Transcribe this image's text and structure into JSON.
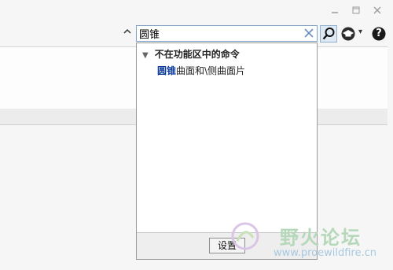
{
  "window": {
    "minimize_icon": "minimize-icon",
    "restore_icon": "restore-icon",
    "close_icon": "close-icon"
  },
  "toolbar": {
    "collapse_icon": "chevron-up-icon",
    "search_icon": "magnifier-icon",
    "community_icon": "graduation-cap-icon",
    "help_icon": "help-icon",
    "help_glyph": "?",
    "dropdown_glyph": "▾"
  },
  "search": {
    "value": "圆锥",
    "clear_icon": "clear-x-icon"
  },
  "results": {
    "group_triangle": "▼",
    "group_label": "不在功能区中的命令",
    "items": [
      {
        "highlight": "圆锥",
        "rest": "曲面和\\侧曲面片"
      }
    ]
  },
  "footer": {
    "settings_label": "设置"
  },
  "watermark": {
    "text": "野火论坛",
    "url": "www.proewildfire.cn"
  },
  "colors": {
    "accent": "#0b3b9c",
    "search_border": "#7fa3c6",
    "watermark": "#b6d8ba"
  }
}
